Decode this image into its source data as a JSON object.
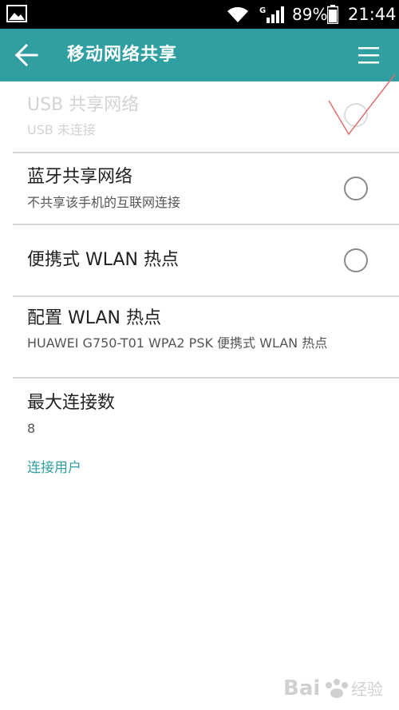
{
  "status_bar": {
    "network_type": "G",
    "battery": "89%",
    "time": "21:44"
  },
  "app_bar": {
    "title": "移动网络共享",
    "back_icon": "arrow-left-icon",
    "menu_icon": "hamburger-menu-icon",
    "color": "#2f9fa1"
  },
  "items": [
    {
      "title": "USB 共享网络",
      "summary": "USB 未连接",
      "enabled": false,
      "checked": false
    },
    {
      "title": "蓝牙共享网络",
      "summary": "不共享该手机的互联网连接",
      "enabled": true,
      "checked": false
    },
    {
      "title": "便携式 WLAN 热点",
      "enabled": true,
      "checked": false
    },
    {
      "title": "配置 WLAN 热点",
      "summary": "HUAWEI G750-T01 WPA2 PSK 便携式 WLAN 热点"
    },
    {
      "title": "最大连接数",
      "summary": "8"
    }
  ],
  "connected_users_link": "连接用户",
  "watermark_text": "Bai 经验",
  "accent_color": "#2f9fa1"
}
